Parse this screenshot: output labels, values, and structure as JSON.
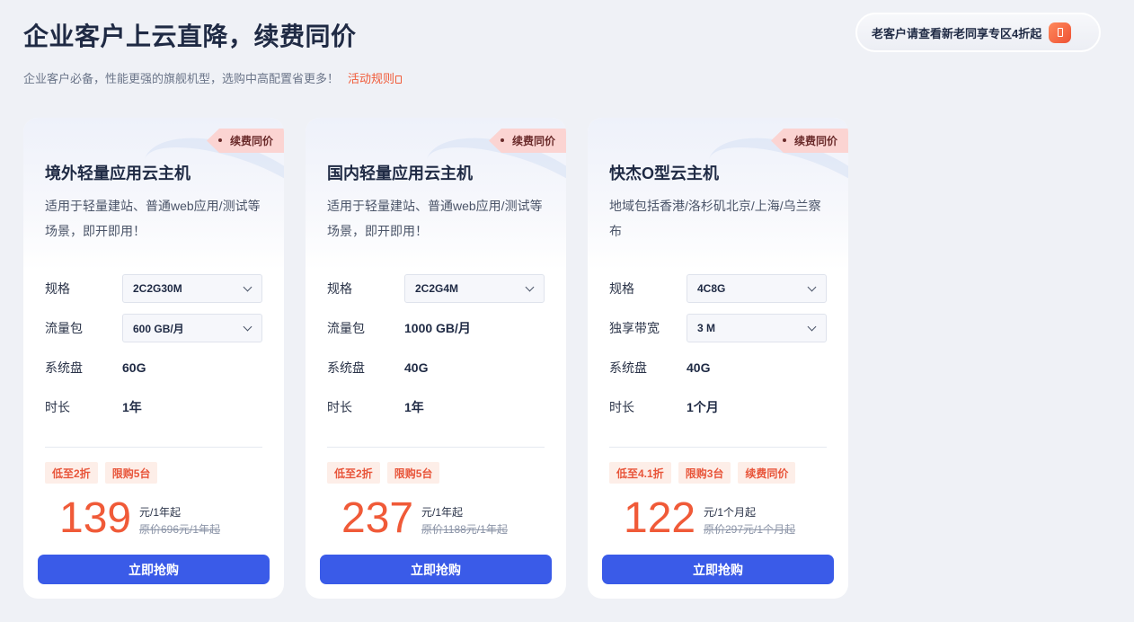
{
  "header": {
    "title": "企业客户上云直降，续费同价",
    "subtitle": "企业客户必备，性能更强的旗舰机型，选购中高配置省更多！",
    "rules_link": "活动规则",
    "promo_button": "老客户请查看新老同享专区4折起"
  },
  "cards": [
    {
      "ribbon": "续费同价",
      "title": "境外轻量应用云主机",
      "description": "适用于轻量建站、普通web应用/测试等场景，即开即用！",
      "specs": [
        {
          "label": "规格",
          "value": "2C2G30M",
          "type": "select"
        },
        {
          "label": "流量包",
          "value": "600 GB/月",
          "type": "select"
        },
        {
          "label": "系统盘",
          "value": "60G",
          "type": "text"
        },
        {
          "label": "时长",
          "value": "1年",
          "type": "text"
        }
      ],
      "tags": [
        "低至2折",
        "限购5台"
      ],
      "price": "139",
      "price_unit": "元/1年起",
      "original_price": "原价696元/1年起",
      "buy_label": "立即抢购"
    },
    {
      "ribbon": "续费同价",
      "title": "国内轻量应用云主机",
      "description": "适用于轻量建站、普通web应用/测试等场景，即开即用！",
      "specs": [
        {
          "label": "规格",
          "value": "2C2G4M",
          "type": "select"
        },
        {
          "label": "流量包",
          "value": "1000 GB/月",
          "type": "text"
        },
        {
          "label": "系统盘",
          "value": "40G",
          "type": "text"
        },
        {
          "label": "时长",
          "value": "1年",
          "type": "text"
        }
      ],
      "tags": [
        "低至2折",
        "限购5台"
      ],
      "price": "237",
      "price_unit": "元/1年起",
      "original_price": "原价1188元/1年起",
      "buy_label": "立即抢购"
    },
    {
      "ribbon": "续费同价",
      "title": "快杰O型云主机",
      "description": "地域包括香港/洛杉矶北京/上海/乌兰察布",
      "specs": [
        {
          "label": "规格",
          "value": "4C8G",
          "type": "select"
        },
        {
          "label": "独享带宽",
          "value": "3 M",
          "type": "select"
        },
        {
          "label": "系统盘",
          "value": "40G",
          "type": "text"
        },
        {
          "label": "时长",
          "value": "1个月",
          "type": "text"
        }
      ],
      "tags": [
        "低至4.1折",
        "限购3台",
        "续费同价"
      ],
      "price": "122",
      "price_unit": "元/1个月起",
      "original_price": "原价297元/1个月起",
      "buy_label": "立即抢购"
    }
  ]
}
